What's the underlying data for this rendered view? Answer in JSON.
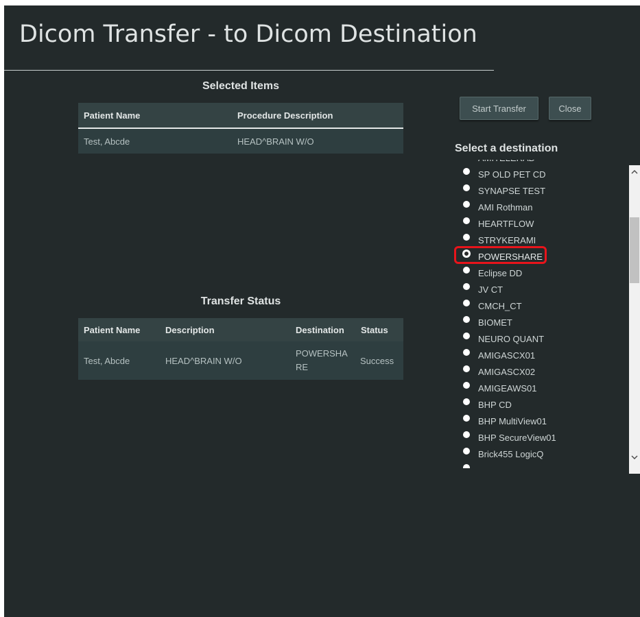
{
  "title": "Dicom Transfer - to Dicom Destination",
  "selected_items": {
    "heading": "Selected Items",
    "columns": [
      "Patient Name",
      "Procedure Description"
    ],
    "rows": [
      [
        "Test, Abcde",
        "HEAD^BRAIN W/O"
      ]
    ]
  },
  "transfer_status": {
    "heading": "Transfer Status",
    "columns": [
      "Patient Name",
      "Description",
      "Destination",
      "Status"
    ],
    "rows": [
      [
        "Test, Abcde",
        "HEAD^BRAIN W/O",
        "POWERSHARE",
        "Success"
      ]
    ]
  },
  "buttons": {
    "start_transfer": "Start Transfer",
    "close": "Close"
  },
  "destinations": {
    "heading": "Select a destination",
    "selected": "POWERSHARE",
    "items": [
      "AMITELERAD",
      "SP OLD PET CD",
      "SYNAPSE TEST",
      "AMI Rothman",
      "HEARTFLOW",
      "STRYKERAMI",
      "POWERSHARE",
      "Eclipse DD",
      "JV CT",
      "CMCH_CT",
      "BIOMET",
      "NEURO QUANT",
      "AMIGASCX01",
      "AMIGASCX02",
      "AMIGEAWS01",
      "BHP CD",
      "BHP MultiView01",
      "BHP SecureView01",
      "Brick455 LogicQ",
      ""
    ]
  },
  "colors": {
    "background": "#232a2b",
    "highlight": "#e8141b"
  },
  "icons": {
    "scroll_up": "chevron-up-icon",
    "scroll_down": "chevron-down-icon"
  }
}
